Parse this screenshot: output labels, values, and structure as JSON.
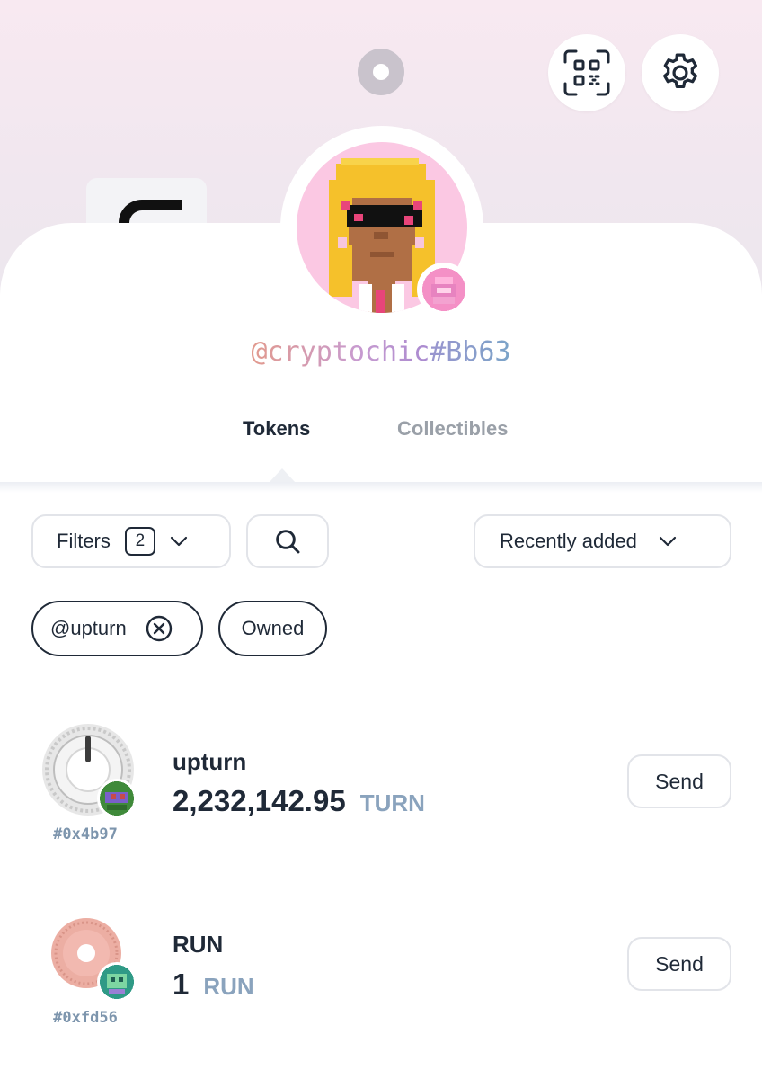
{
  "profile": {
    "handle_name": "@cryptochic",
    "handle_tag": "#Bb63"
  },
  "header": {
    "qr_icon": "qr-scan-icon",
    "settings_icon": "gear-icon"
  },
  "tabs": [
    {
      "label": "Tokens",
      "active": true
    },
    {
      "label": "Collectibles",
      "active": false
    }
  ],
  "toolbar": {
    "filters_label": "Filters",
    "filters_count": "2",
    "sort_label": "Recently added"
  },
  "chips": [
    {
      "label": "@upturn",
      "removable": true
    },
    {
      "label": "Owned",
      "removable": false
    }
  ],
  "tokens": [
    {
      "name": "upturn",
      "amount": "2,232,142.95",
      "symbol": "TURN",
      "address": "#0x4b97",
      "action": "Send"
    },
    {
      "name": "RUN",
      "amount": "1",
      "symbol": "RUN",
      "address": "#0xfd56",
      "action": "Send"
    }
  ],
  "colors": {
    "text": "#1f2937",
    "muted": "#9aa0a8",
    "symbol": "#8aa3bd",
    "border": "#e2e4e9"
  }
}
